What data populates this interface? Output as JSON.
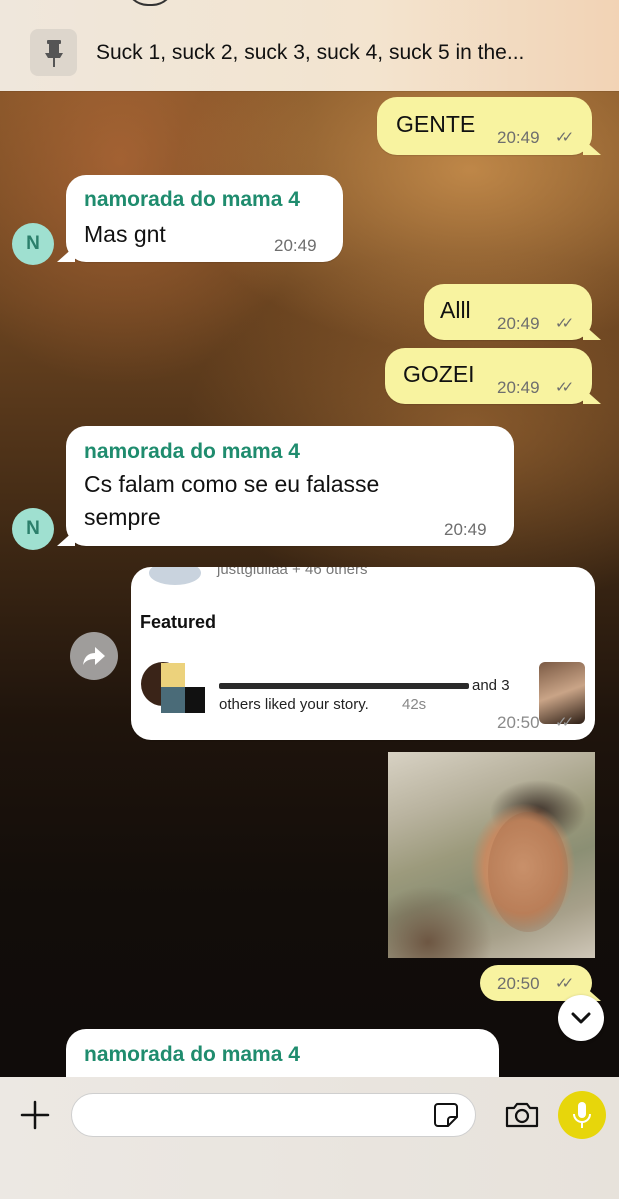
{
  "pinned_message": {
    "text": "Suck 1, suck 2, suck 3, suck 4, suck 5 in the..."
  },
  "messages": [
    {
      "text": "GENTE",
      "time": "20:49"
    },
    {
      "sender": "namorada do mama 4",
      "text": "Mas gnt",
      "time": "20:49",
      "avatar": "N"
    },
    {
      "text": "Alll",
      "time": "20:49"
    },
    {
      "text": "GOZEI",
      "time": "20:49"
    },
    {
      "sender": "namorada do mama 4",
      "line1": "Cs falam como se eu falasse",
      "line2": "sempre",
      "time": "20:49",
      "avatar": "N"
    },
    {
      "shared_top": "justtgiuliaa + 46 others",
      "shared_section": "Featured",
      "shared_line1": "and 3",
      "shared_line2": "others liked your story.",
      "shared_age": "42s",
      "time": "20:50"
    },
    {
      "time": "20:50"
    },
    {
      "sender": "namorada do mama 4"
    }
  ],
  "icons": {
    "pin": "pushpin-icon",
    "forward": "forward-arrow-icon",
    "scroll": "chevron-down-icon",
    "add": "plus-icon",
    "sticker": "sticker-icon",
    "camera": "camera-icon",
    "mic": "microphone-icon"
  },
  "colors": {
    "outgoing_bubble": "#f8f3a0",
    "incoming_bubble": "#ffffff",
    "sender_name": "#1f8c6e",
    "mic_button": "#e7d60b"
  }
}
